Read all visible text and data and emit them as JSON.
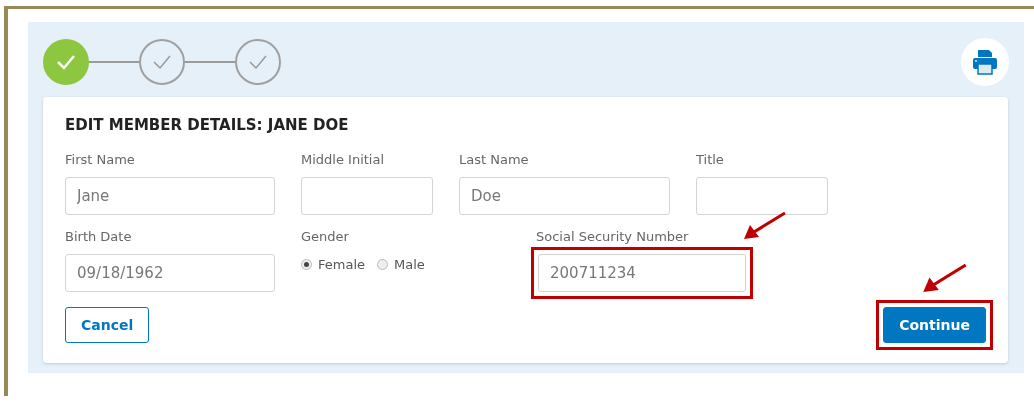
{
  "steps": [
    {
      "completed": true
    },
    {
      "completed": false
    },
    {
      "completed": false
    }
  ],
  "form": {
    "title": "EDIT MEMBER DETAILS: JANE DOE",
    "row_1": [
      {
        "label": "First Name",
        "value": "Jane"
      },
      {
        "label": "Middle Initial"
      },
      {
        "label": "Last Name",
        "value": "Doe"
      },
      {
        "label": "Title"
      }
    ],
    "birth_date": {
      "label": "Birth Date",
      "value": "09/18/1962"
    },
    "gender": {
      "label": "Gender",
      "options": [
        {
          "label": "Female",
          "selected": true
        },
        {
          "label": "Male",
          "selected": false
        }
      ]
    },
    "ssn": {
      "label": "Social Security Number",
      "value": "200711234",
      "highlighted": true
    }
  },
  "buttons": {
    "cancel": {
      "label": "Cancel"
    },
    "continue": {
      "label": "Continue",
      "highlighted": true
    }
  }
}
